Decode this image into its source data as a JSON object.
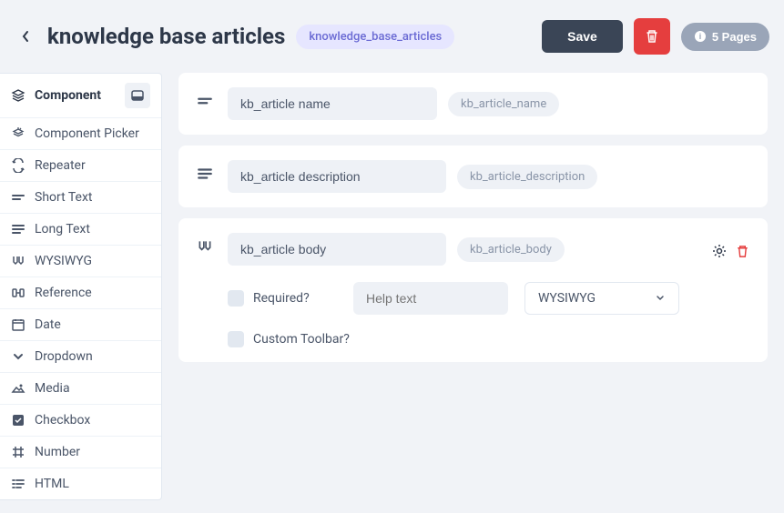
{
  "header": {
    "title": "knowledge base articles",
    "slug": "knowledge_base_articles",
    "save_label": "Save",
    "pages_label": "5 Pages"
  },
  "sidebar": {
    "header": "Component",
    "items": [
      {
        "icon": "component-picker-icon",
        "label": "Component Picker"
      },
      {
        "icon": "repeater-icon",
        "label": "Repeater"
      },
      {
        "icon": "short-text-icon",
        "label": "Short Text"
      },
      {
        "icon": "long-text-icon",
        "label": "Long Text"
      },
      {
        "icon": "wysiwyg-icon",
        "label": "WYSIWYG"
      },
      {
        "icon": "reference-icon",
        "label": "Reference"
      },
      {
        "icon": "date-icon",
        "label": "Date"
      },
      {
        "icon": "dropdown-icon",
        "label": "Dropdown"
      },
      {
        "icon": "media-icon",
        "label": "Media"
      },
      {
        "icon": "checkbox-icon",
        "label": "Checkbox"
      },
      {
        "icon": "number-icon",
        "label": "Number"
      },
      {
        "icon": "html-icon",
        "label": "HTML"
      }
    ]
  },
  "fields": [
    {
      "icon": "short-text-icon",
      "name": "kb_article name",
      "slug": "kb_article_name",
      "expanded": false
    },
    {
      "icon": "long-text-icon",
      "name": "kb_article description",
      "slug": "kb_article_description",
      "expanded": false
    },
    {
      "icon": "wysiwyg-icon",
      "name": "kb_article body",
      "slug": "kb_article_body",
      "expanded": true,
      "settings": {
        "required_label": "Required?",
        "help_placeholder": "Help text",
        "type_value": "WYSIWYG",
        "custom_toolbar_label": "Custom Toolbar?"
      }
    }
  ]
}
